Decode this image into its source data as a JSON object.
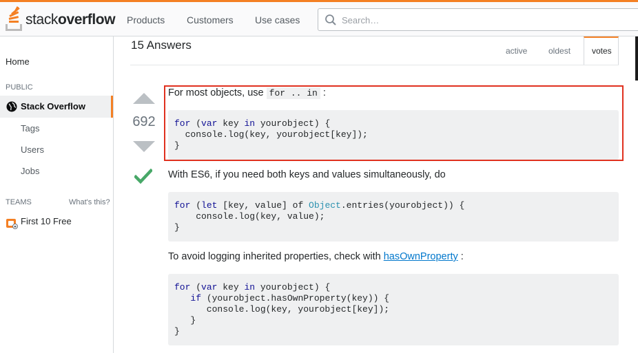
{
  "header": {
    "logo_prefix": "stack",
    "logo_bold": "overflow",
    "nav": [
      "Products",
      "Customers",
      "Use cases"
    ],
    "search_placeholder": "Search…",
    "accent_color": "#f48024"
  },
  "sidebar": {
    "home": "Home",
    "public_label": "PUBLIC",
    "active_item": "Stack Overflow",
    "sub_items": [
      "Tags",
      "Users",
      "Jobs"
    ],
    "teams_label": "TEAMS",
    "whats_this": "What's this?",
    "first_free": "First 10 Free"
  },
  "answers": {
    "title": "15 Answers",
    "tabs": [
      "active",
      "oldest",
      "votes"
    ],
    "selected_tab": "votes"
  },
  "answer": {
    "votes": "692",
    "accepted": true,
    "p1_text": "For most objects, use ",
    "p1_code": "for .. in",
    "p1_end": " :",
    "code1": {
      "l1_kw1": "for",
      "l1_a": " (",
      "l1_kw2": "var",
      "l1_b": " key ",
      "l1_kw3": "in",
      "l1_c": " yourobject) {",
      "l2": "  console.log(key, yourobject[key]);",
      "l3": "}"
    },
    "p2": "With ES6, if you need both keys and values simultaneously, do",
    "code2": {
      "l1_kw1": "for",
      "l1_a": " (",
      "l1_kw2": "let",
      "l1_b": " [key, value] of ",
      "l1_ty": "Object",
      "l1_c": ".entries(yourobject)) {",
      "l2": "    console.log(key, value);",
      "l3": "}"
    },
    "p3_text": "To avoid logging inherited properties, check with ",
    "p3_link": "hasOwnProperty",
    "p3_end": " :",
    "code3": {
      "l1_kw1": "for",
      "l1_a": " (",
      "l1_kw2": "var",
      "l1_b": " key ",
      "l1_kw3": "in",
      "l1_c": " yourobject) {",
      "l2_pre": "   ",
      "l2_kw": "if",
      "l2_c": " (yourobject.hasOwnProperty(key)) {",
      "l3": "      console.log(key, yourobject[key]);",
      "l4": "   }",
      "l5": "}"
    },
    "highlight_color": "#e0301e"
  }
}
